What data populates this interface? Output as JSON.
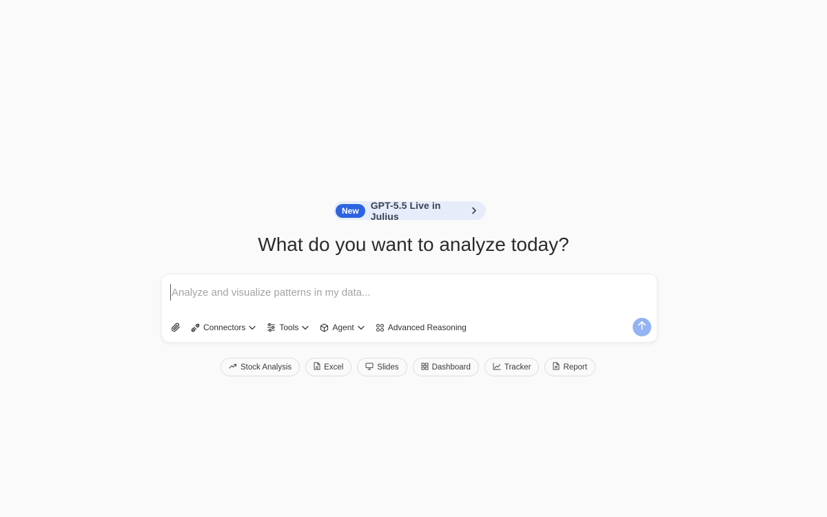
{
  "announcement": {
    "badge": "New",
    "text": "GPT-5.5 Live in Julius"
  },
  "heading": "What do you want to analyze today?",
  "composer": {
    "placeholder": "Analyze and visualize patterns in my data...",
    "value": "",
    "tools": {
      "connectors": "Connectors",
      "tools": "Tools",
      "agent": "Agent",
      "reasoning": "Advanced Reasoning"
    }
  },
  "chips": {
    "stock": "Stock Analysis",
    "excel": "Excel",
    "slides": "Slides",
    "dashboard": "Dashboard",
    "tracker": "Tracker",
    "report": "Report"
  },
  "colors": {
    "background": "#fafafa",
    "badge": "#2c63e0",
    "announce_bg": "#e6ecfa",
    "send_button": "#94b3f2"
  }
}
